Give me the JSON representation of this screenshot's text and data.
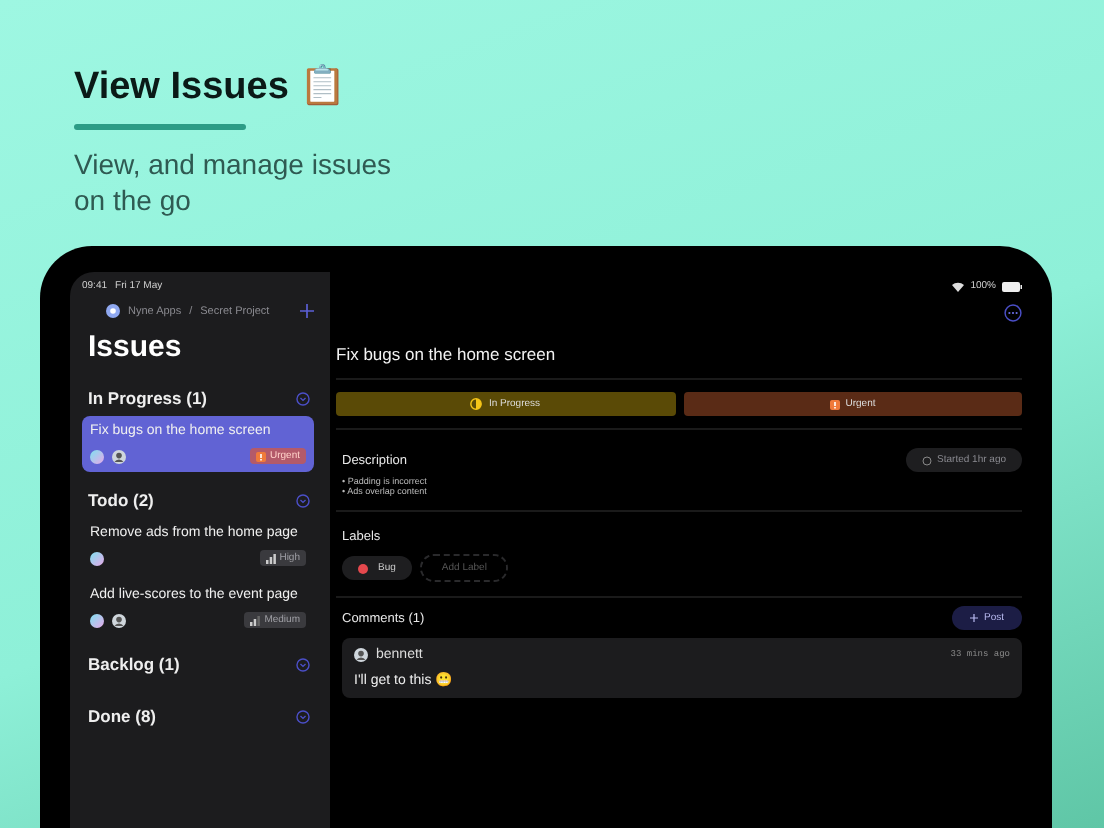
{
  "header": {
    "title": "View Issues 📋",
    "subtitle": "View, and manage issues on the go"
  },
  "status_bar": {
    "time": "09:41",
    "date": "Fri 17 May",
    "battery": "100%"
  },
  "sidebar": {
    "breadcrumb": [
      "Nyne Apps",
      "/",
      "Secret Project"
    ],
    "title": "Issues",
    "groups": [
      {
        "title": "In Progress (1)",
        "issues": [
          {
            "title": "Fix bugs on the home screen",
            "selected": true,
            "avatars": [
              {
                "kind": "gradient"
              },
              {
                "kind": "photo"
              }
            ],
            "priority": {
              "kind": "urgent",
              "label": "Urgent"
            }
          }
        ]
      },
      {
        "title": "Todo (2)",
        "issues": [
          {
            "title": "Remove ads from the home page",
            "selected": false,
            "avatars": [
              {
                "kind": "gradient"
              }
            ],
            "priority": {
              "kind": "high",
              "label": "High"
            }
          },
          {
            "title": "Add live-scores to the event page",
            "selected": false,
            "avatars": [
              {
                "kind": "gradient"
              },
              {
                "kind": "photo"
              }
            ],
            "priority": {
              "kind": "medium",
              "label": "Medium"
            }
          }
        ]
      },
      {
        "title": "Backlog (1)"
      },
      {
        "title": "Done (8)"
      }
    ]
  },
  "detail": {
    "title": "Fix bugs on the home screen",
    "chips": [
      {
        "kind": "progress",
        "label": "In Progress"
      },
      {
        "kind": "urgent",
        "label": "Urgent"
      }
    ],
    "description": {
      "heading": "Description",
      "started": "Started 1hr ago",
      "bullets": [
        "• Padding is incorrect",
        "• Ads overlap content"
      ]
    },
    "labels": {
      "heading": "Labels",
      "items": [
        {
          "name": "Bug",
          "color": "#e5484d"
        }
      ],
      "add_placeholder": "Add Label"
    },
    "comments": {
      "heading": "Comments (1)",
      "post": "Post",
      "items": [
        {
          "author": "bennett",
          "time": "33 mins ago",
          "text": "I'll get to this 😬"
        }
      ]
    }
  }
}
